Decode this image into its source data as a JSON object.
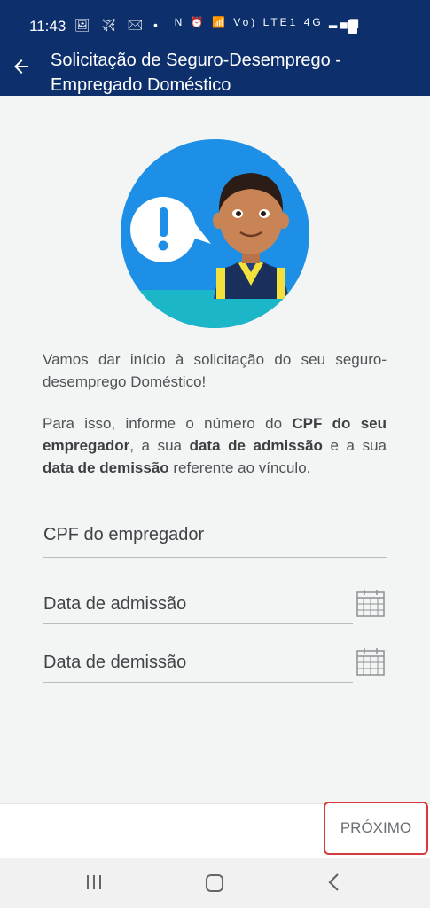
{
  "status_bar": {
    "time": "11:43",
    "left_icons": "🖼 ✈ ✉ •",
    "right_icons": "N ⏰ 📶 Vo) LTE1 4G ▂▄▆"
  },
  "header": {
    "title": "Solicitação de Seguro-Desemprego - Empregado Doméstico"
  },
  "intro": {
    "p1": "Vamos dar início à solicitação do seu seguro-desemprego Doméstico!",
    "p2_pre": "Para isso, informe o número do ",
    "p2_b1": "CPF do seu empregador",
    "p2_mid1": ", a sua ",
    "p2_b2": "data de admissão",
    "p2_mid2": " e a sua ",
    "p2_b3": "data de demissão",
    "p2_post": " referente ao vínculo."
  },
  "form": {
    "cpf_placeholder": "CPF do empregador",
    "admissao_placeholder": "Data de admissão",
    "demissao_placeholder": "Data de demissão"
  },
  "actions": {
    "next_label": "PRÓXIMO"
  },
  "colors": {
    "header_bg": "#0d2f6b",
    "hero_blue": "#1e8fe6",
    "button_border": "#d63b3b"
  }
}
